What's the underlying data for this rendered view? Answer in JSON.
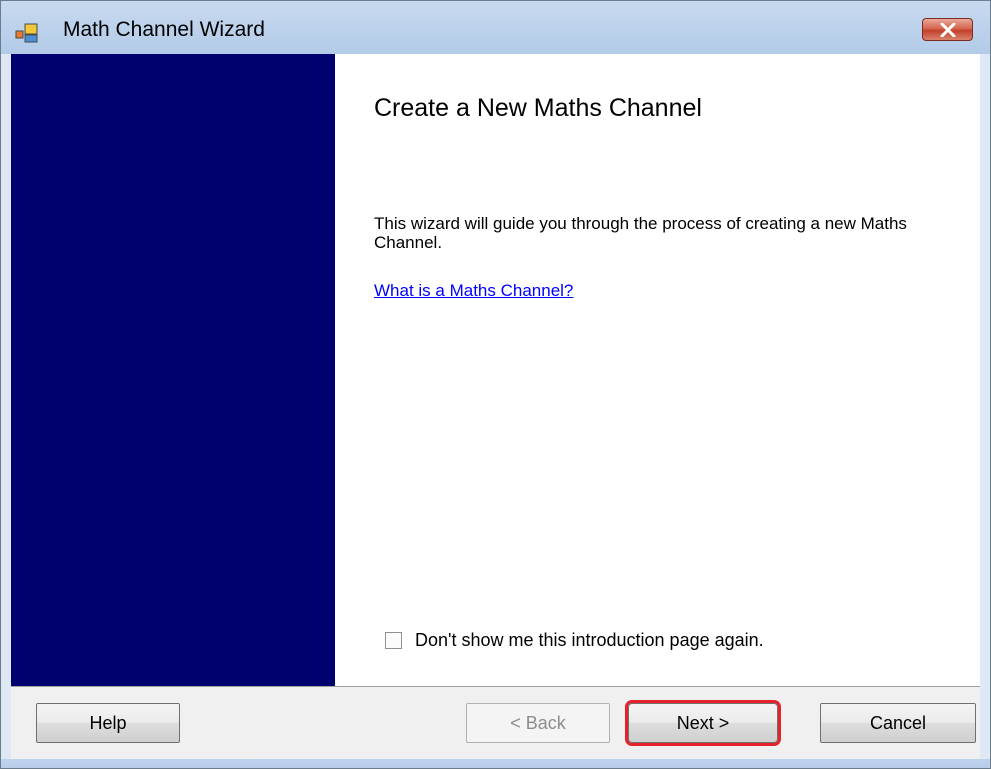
{
  "window": {
    "title": "Math Channel Wizard"
  },
  "content": {
    "title": "Create a New Maths Channel",
    "intro": "This wizard will guide you through the process of creating a new Maths Channel.",
    "help_link": "What is a Maths Channel?",
    "checkbox_label": "Don't show me this introduction page again.",
    "checkbox_checked": false
  },
  "buttons": {
    "help": "Help",
    "back": "< Back",
    "next": "Next >",
    "cancel": "Cancel"
  },
  "colors": {
    "sidebar": "#00006f",
    "highlight": "#e5212b",
    "link": "#0000ff"
  }
}
